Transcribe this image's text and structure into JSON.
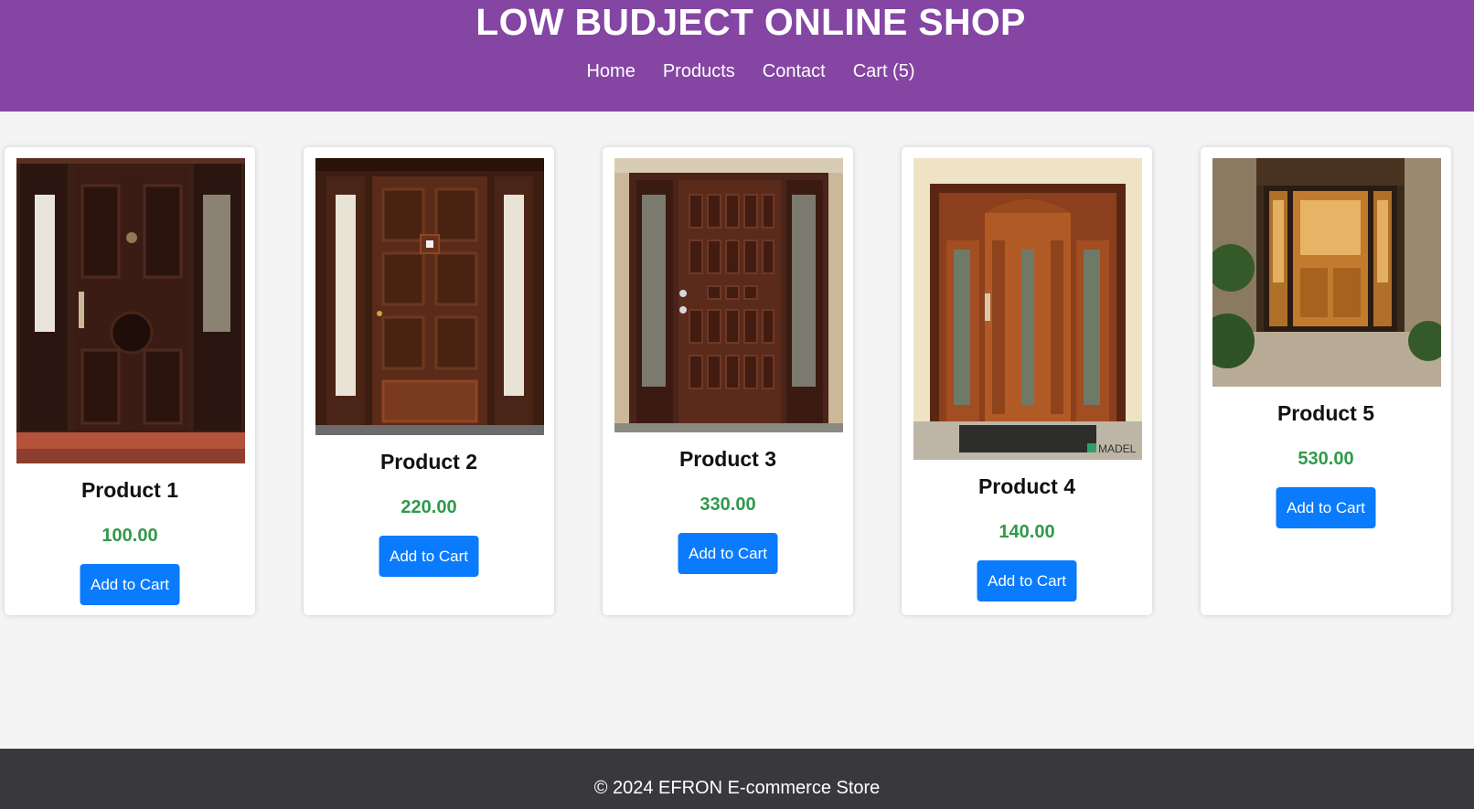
{
  "header": {
    "title": "LOW BUDJECT ONLINE SHOP",
    "nav": [
      {
        "label": "Home"
      },
      {
        "label": "Products"
      },
      {
        "label": "Contact"
      },
      {
        "label": "Cart (5)"
      }
    ]
  },
  "products": [
    {
      "name": "Product 1",
      "price": "100.00",
      "button": "Add to Cart"
    },
    {
      "name": "Product 2",
      "price": "220.00",
      "button": "Add to Cart"
    },
    {
      "name": "Product 3",
      "price": "330.00",
      "button": "Add to Cart"
    },
    {
      "name": "Product 4",
      "price": "140.00",
      "button": "Add to Cart"
    },
    {
      "name": "Product 5",
      "price": "530.00",
      "button": "Add to Cart"
    }
  ],
  "image_watermark": "MADEL",
  "footer": {
    "text": "© 2024 EFRON E-commerce Store"
  },
  "colors": {
    "header_bg": "#8445a3",
    "footer_bg": "#39383d",
    "price": "#2f9a4a",
    "button": "#0a7bfc",
    "page_bg": "#f4f4f4"
  }
}
